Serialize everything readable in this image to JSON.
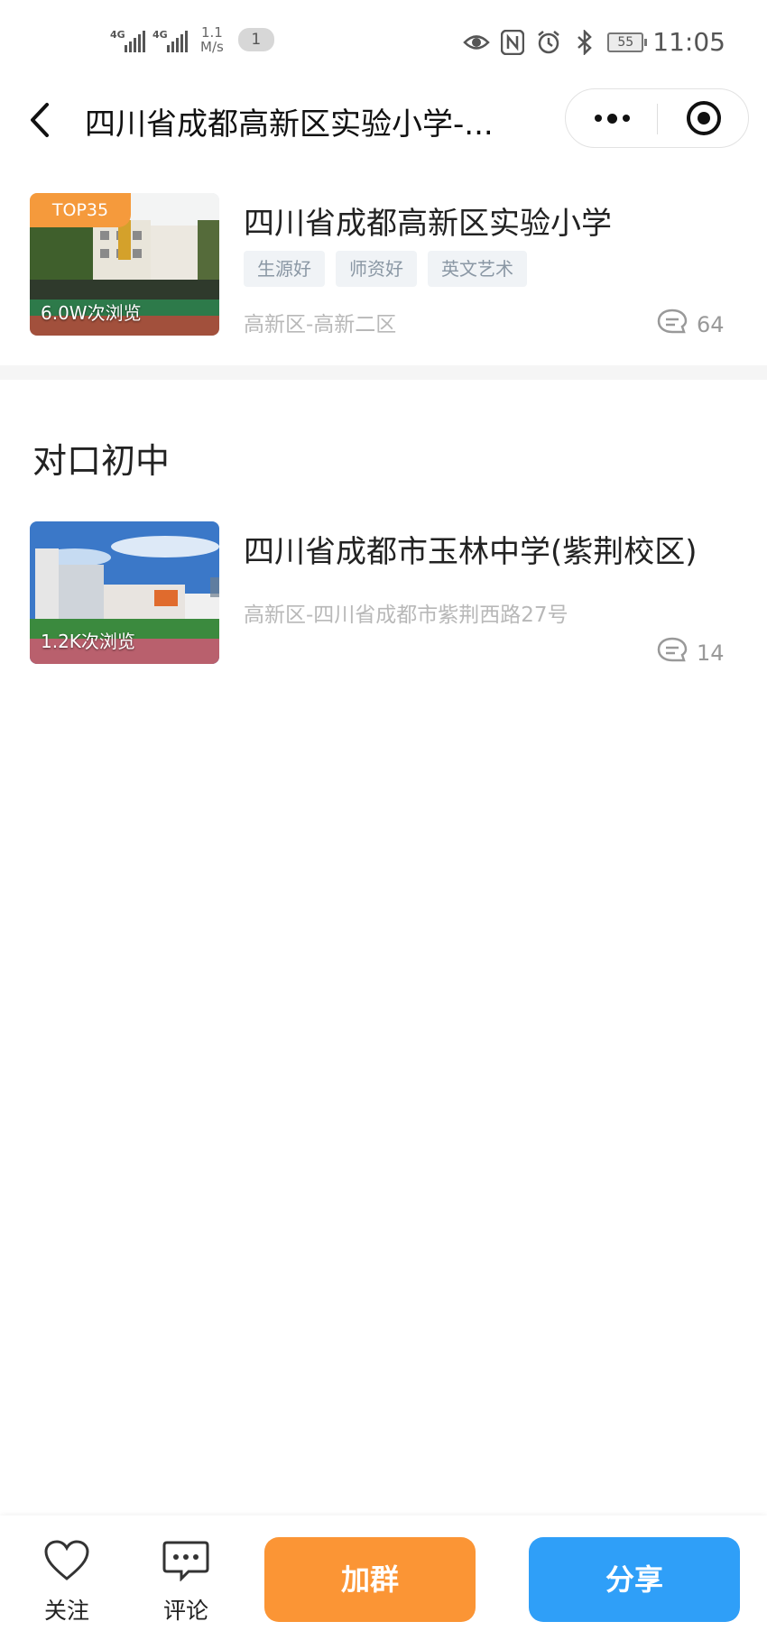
{
  "status_bar": {
    "network1": "4G",
    "network2": "4G",
    "speed_value": "1.1",
    "speed_unit": "M/s",
    "notification_count": "1",
    "battery": "55",
    "time": "11:05",
    "icons": [
      "eye-icon",
      "nfc-icon",
      "alarm-icon",
      "bluetooth-icon"
    ]
  },
  "nav": {
    "title": "四川省成都高新区实验小学-...",
    "icons": [
      "back-arrow-icon",
      "more-dots-icon",
      "target-close-icon"
    ]
  },
  "school": {
    "rank_badge": "TOP35",
    "views": "6.0W次浏览",
    "name": "四川省成都高新区实验小学",
    "tags": [
      "生源好",
      "师资好",
      "英文艺术"
    ],
    "address": "高新区-高新二区",
    "comment_count": "64"
  },
  "section": {
    "title": "对口初中"
  },
  "middle_school": {
    "views": "1.2K次浏览",
    "name": "四川省成都市玉林中学(紫荆校区)",
    "address": "高新区-四川省成都市紫荆西路27号",
    "comment_count": "14"
  },
  "bottom_bar": {
    "follow_label": "关注",
    "comment_label": "评论",
    "join_group_label": "加群",
    "share_label": "分享",
    "join_color": "#fb9535",
    "share_color": "#2f9ff8"
  }
}
